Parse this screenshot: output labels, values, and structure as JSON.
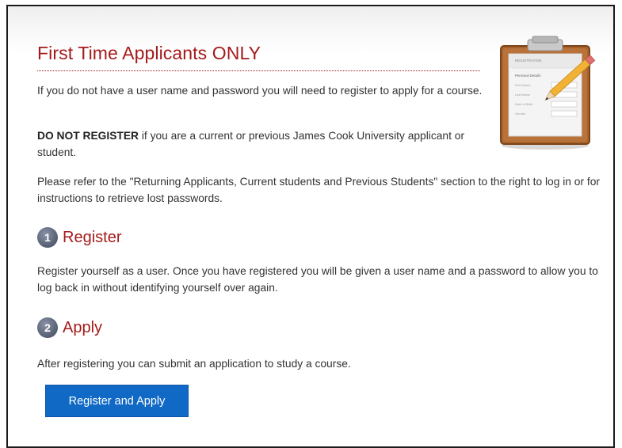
{
  "heading": "First Time Applicants ONLY",
  "intro": {
    "p1": "If you do not have a user name and password you will need to register to apply for a course.",
    "p2_bold": "DO NOT REGISTER",
    "p2_rest": " if you are a current or previous James Cook University applicant or student.",
    "p3": "Please refer to the \"Returning Applicants, Current students and Previous Students\" section to the right to log in or for instructions to retrieve lost passwords."
  },
  "steps": [
    {
      "number": "1",
      "title": "Register",
      "description": "Register yourself as a user. Once you have registered you will be given a user name and a password to allow you to log back in without identifying yourself over again."
    },
    {
      "number": "2",
      "title": "Apply",
      "description": "After registering you can submit an application to study a course."
    }
  ],
  "button": {
    "label": "Register and Apply"
  },
  "illustration": {
    "icon": "clipboard-registration-icon",
    "form_title": "REGISTRATION",
    "form_section": "Personal Details",
    "form_fields": [
      "First Name",
      "Last Name",
      "Date of Birth",
      "Gender"
    ]
  },
  "colors": {
    "heading": "#a41b1b",
    "button": "#1169c6",
    "text": "#333333"
  }
}
